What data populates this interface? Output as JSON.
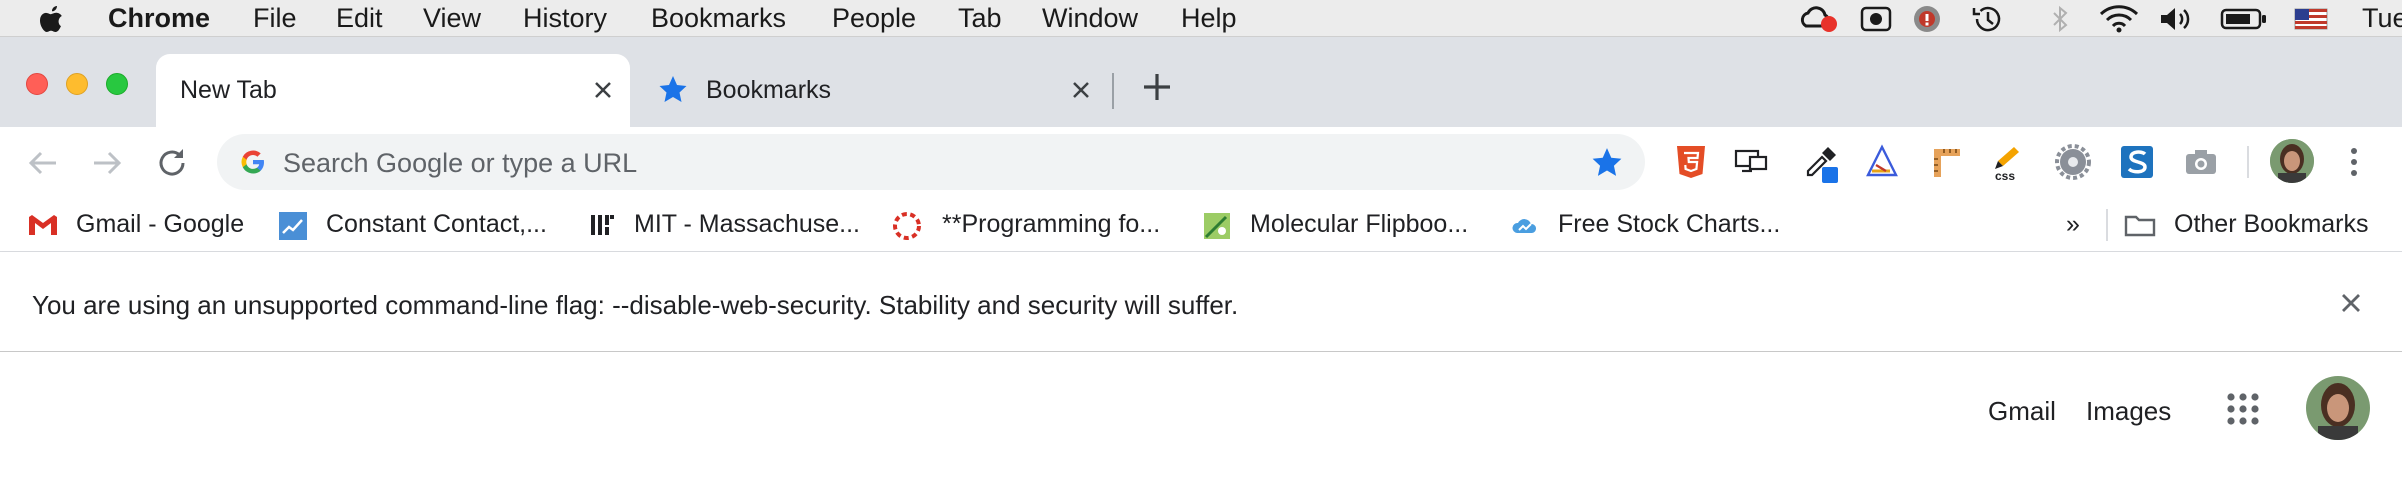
{
  "menubar": {
    "app_name": "Chrome",
    "items": [
      "File",
      "Edit",
      "View",
      "History",
      "Bookmarks",
      "People",
      "Tab",
      "Window",
      "Help"
    ],
    "clock": "Tue"
  },
  "tabs": [
    {
      "title": "New Tab",
      "active": true
    },
    {
      "title": "Bookmarks",
      "active": false
    }
  ],
  "omnibox": {
    "placeholder": "Search Google or type a URL"
  },
  "bookmarks": [
    {
      "label": "Gmail - Google"
    },
    {
      "label": "Constant Contact,..."
    },
    {
      "label": "MIT - Massachuse..."
    },
    {
      "label": "**Programming fo..."
    },
    {
      "label": "Molecular Flipboo..."
    },
    {
      "label": "Free Stock Charts..."
    }
  ],
  "bookmarks_overflow": "»",
  "other_bookmarks": "Other Bookmarks",
  "infobar": {
    "message": "You are using an unsupported command-line flag: --disable-web-security. Stability and security will suffer."
  },
  "google_links": {
    "gmail": "Gmail",
    "images": "Images"
  },
  "colors": {
    "accent_blue": "#1a73e8",
    "tabstrip": "#dee1e6",
    "close_red": "#ff5f57",
    "minimize_yellow": "#febc2e",
    "zoom_green": "#28c840"
  }
}
